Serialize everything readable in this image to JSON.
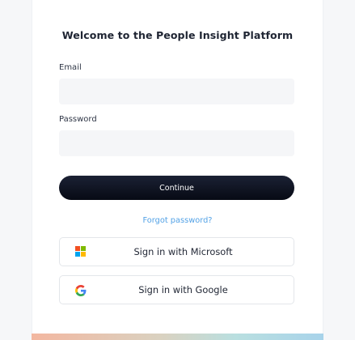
{
  "login": {
    "title": "Welcome to the People Insight Platform",
    "email_label": "Email",
    "email_value": "",
    "password_label": "Password",
    "password_value": "",
    "continue_label": "Continue",
    "forgot_label": "Forgot password?",
    "microsoft_label": "Sign in with Microsoft",
    "google_label": "Sign in with Google"
  },
  "icons": {
    "microsoft": "microsoft-logo-icon",
    "google": "google-logo-icon"
  },
  "colors": {
    "primary_button": "#0b0f1c",
    "link": "#53a2e6",
    "input_bg": "#f5f6f8",
    "microsoft": [
      "#f25022",
      "#7fba00",
      "#00a4ef",
      "#ffb900"
    ]
  }
}
